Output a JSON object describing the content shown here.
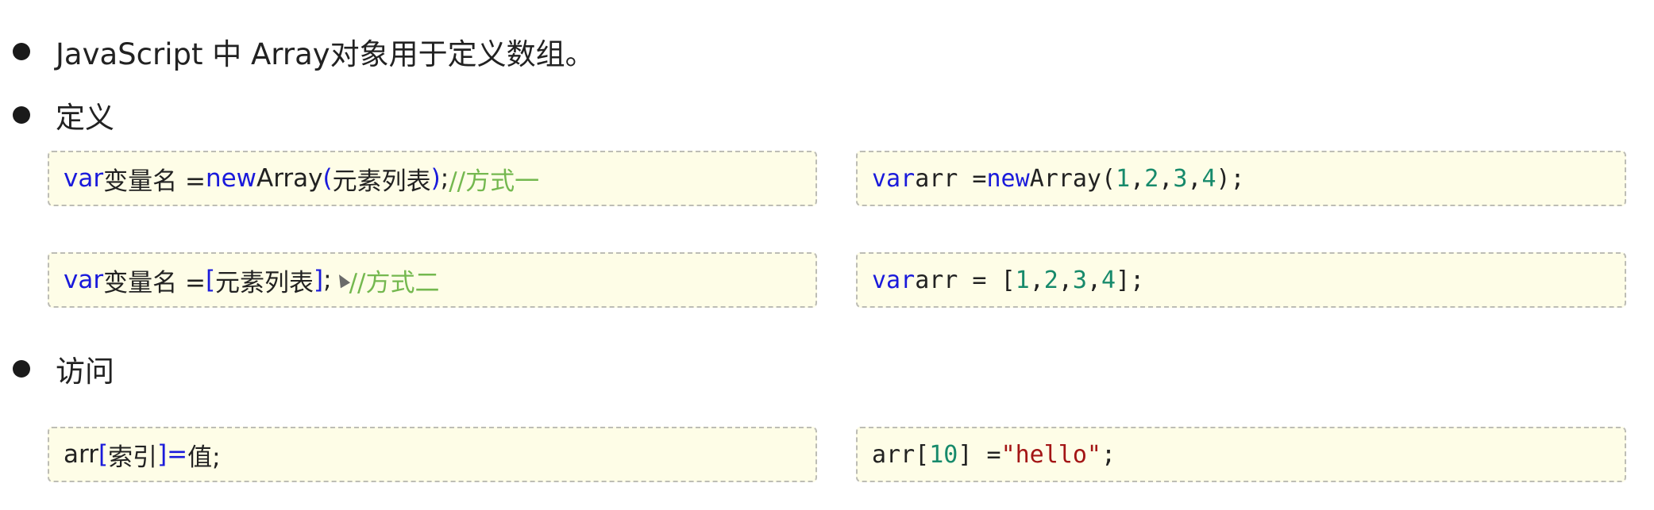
{
  "bullets": {
    "intro": "JavaScript 中 Array对象用于定义数组。",
    "define": "定义",
    "access": "访问"
  },
  "code": {
    "def1_left": {
      "kw_var": "var",
      "name": " 变量名 = ",
      "kw_new": "new",
      "ctor": " Array",
      "paren_open": "(",
      "elements": "元素列表",
      "paren_close": ")",
      "semi": "; ",
      "comment": "//方式一"
    },
    "def1_right": {
      "kw_var": "var",
      "mid": " arr = ",
      "kw_new": "new",
      "ctor": " Array(",
      "n1": "1",
      "c1": ",",
      "n2": "2",
      "c2": ",",
      "n3": "3",
      "c3": ",",
      "n4": "4",
      "end": ");"
    },
    "def2_left": {
      "kw_var": "var",
      "name": " 变量名 = ",
      "bracket_open": "[",
      "elements": " 元素列表 ",
      "bracket_close": "]",
      "semi": "; ",
      "comment": "//方式二"
    },
    "def2_right": {
      "kw_var": "var",
      "mid": " arr = [",
      "n1": "1",
      "c1": ",",
      "n2": "2",
      "c2": ",",
      "n3": "3",
      "c3": ",",
      "n4": "4",
      "end": "];"
    },
    "access_left": {
      "arr": "arr",
      "bracket_open": "[",
      "index": " 索引 ",
      "bracket_close": "]",
      "assign": " = ",
      "value": "值;"
    },
    "access_right": {
      "start": "arr[",
      "index": "10",
      "mid": "] = ",
      "str": "\"hello\"",
      "end": ";"
    }
  }
}
